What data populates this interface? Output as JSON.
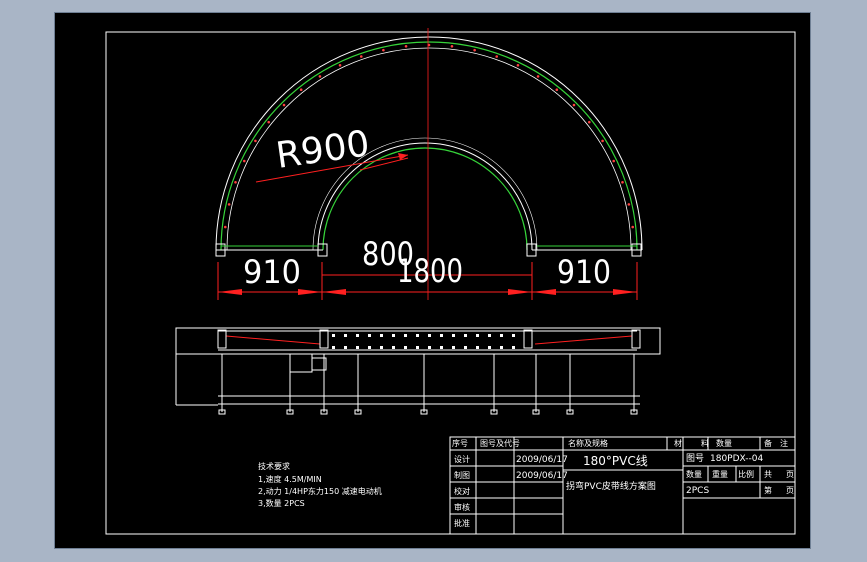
{
  "colors": {
    "background": "#a9b5c6",
    "sheet": "#000000",
    "frame": "#ffffff",
    "dimension": "#ff2020",
    "belt": "#36d43a",
    "centerline": "#ff2020"
  },
  "drawing": {
    "dimensions": {
      "radius": "R900",
      "left_straight": "910",
      "inner_diameter": "800",
      "overall_span": "1800",
      "right_straight": "910"
    },
    "notes": {
      "title": "技术要求",
      "line1": "1,速度 4.5M/MIN",
      "line2": "2,动力 1/4HP东力150 减速电动机",
      "line3": "3,数量 2PCS"
    }
  },
  "title_block": {
    "headers": {
      "seq": "序号",
      "code": "图号及代号",
      "name": "名称及规格",
      "material": "材",
      "material2": "料",
      "qty": "数量",
      "remark": "备",
      "remark2": "注"
    },
    "rows": {
      "design": "设计",
      "drawing": "制图",
      "check": "校对",
      "review": "审核",
      "approve": "批准"
    },
    "dates": {
      "design_date": "2009/06/17",
      "drawing_date": "2009/06/17"
    },
    "product_title": "180°PVC线",
    "product_subtitle": "拐弯PVC皮带线方案图",
    "drawing_no_label": "图号",
    "drawing_no": "180PDX--04",
    "qty_label": "数量",
    "weight_label": "重量",
    "scale_label": "比例",
    "qty_value": "2PCS",
    "sheet_label": "共",
    "sheet_label2": "页",
    "page_label": "第",
    "page_label2": "页"
  }
}
